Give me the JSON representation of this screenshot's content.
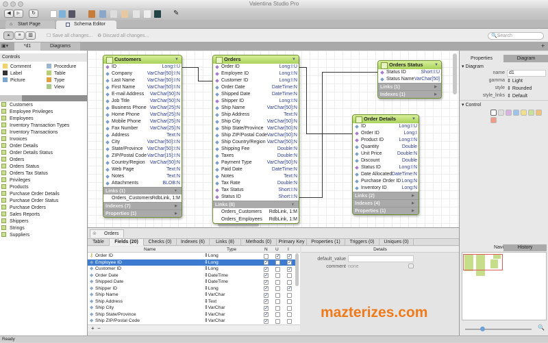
{
  "window": {
    "title": "Valentina Studio Pro"
  },
  "tabs": [
    {
      "label": "Start Page"
    },
    {
      "label": "Schema Editor"
    }
  ],
  "subbar": {
    "save": "Save all changes...",
    "discard": "Discard all changes...",
    "search_placeholder": "Search"
  },
  "doctabs": [
    {
      "label": "*d1"
    },
    {
      "label": "Diagrams"
    }
  ],
  "controls": {
    "title": "Controls",
    "items": [
      "Comment",
      "Label",
      "Picture",
      "Procedure",
      "Table",
      "Type",
      "View"
    ]
  },
  "objects": [
    "Customers",
    "Employee Privileges",
    "Employees",
    "Inventory Transaction Types",
    "Inventory Transactions",
    "Invoices",
    "Order Details",
    "Order Details Status",
    "Orders",
    "Orders Status",
    "Orders Tax Status",
    "Privileges",
    "Products",
    "Purchase Order Details",
    "Purchase Order Status",
    "Purchase Orders",
    "Sales Reports",
    "Shippers",
    "Strings",
    "Suppliers"
  ],
  "entities": [
    {
      "name": "Customers",
      "fields": [
        [
          "ID",
          "Long:I:U",
          1
        ],
        [
          "Company",
          "VarChar[50]:I:N",
          0
        ],
        [
          "Last Name",
          "VarChar[50]:I:N",
          0
        ],
        [
          "First Name",
          "VarChar[50]:I:N",
          0
        ],
        [
          "E-mail Address",
          "VarChar[50]:N",
          0
        ],
        [
          "Job Title",
          "VarChar[50]:N",
          0
        ],
        [
          "Business Phone",
          "VarChar[25]:N",
          0
        ],
        [
          "Home Phone",
          "VarChar[25]:N",
          0
        ],
        [
          "Mobile Phone",
          "VarChar[25]:N",
          0
        ],
        [
          "Fax Number",
          "VarChar[25]:N",
          0
        ],
        [
          "Address",
          "Text:N",
          0
        ],
        [
          "City",
          "VarChar[50]:I:N",
          0
        ],
        [
          "State/Province",
          "VarChar[50]:I:N",
          0
        ],
        [
          "ZIP/Postal Code",
          "VarChar[15]:I:N",
          0
        ],
        [
          "Country/Region",
          "VarChar[50]:N",
          0
        ],
        [
          "Web Page",
          "Text:N",
          0
        ],
        [
          "Notes",
          "Text:N",
          0
        ],
        [
          "Attachments",
          "BLOB:N",
          0
        ]
      ],
      "sections": [
        {
          "label": "Links (1)",
          "open": true,
          "items": [
            [
              "Orders_Customers",
              "RdbLink, 1:M"
            ]
          ]
        },
        {
          "label": "Indexes (7)"
        },
        {
          "label": "Properties (1)"
        }
      ]
    },
    {
      "name": "Orders",
      "fields": [
        [
          "Order ID",
          "Long:I:U",
          1
        ],
        [
          "Employee ID",
          "Long:I:N",
          1
        ],
        [
          "Customer ID",
          "Long:I:N",
          1
        ],
        [
          "Order Date",
          "DateTime:N",
          0
        ],
        [
          "Shipped Date",
          "DateTime:N",
          0
        ],
        [
          "Shipper ID",
          "Long:I:N",
          1
        ],
        [
          "Ship Name",
          "VarChar[50]:N",
          0
        ],
        [
          "Ship Address",
          "Text:N",
          0
        ],
        [
          "Ship City",
          "VarChar[50]:N",
          0
        ],
        [
          "Ship State/Province",
          "VarChar[50]:N",
          0
        ],
        [
          "Ship ZIP/Postal Code",
          "VarChar[50]:N",
          0
        ],
        [
          "Ship Country/Region",
          "VarChar[50]:N",
          0
        ],
        [
          "Shipping Fee",
          "Double:N",
          0
        ],
        [
          "Taxes",
          "Double:N",
          0
        ],
        [
          "Payment Type",
          "VarChar[50]:N",
          0
        ],
        [
          "Paid Date",
          "DateTime:N",
          0
        ],
        [
          "Notes",
          "Text:N",
          0
        ],
        [
          "Tax Rate",
          "Double:N",
          0
        ],
        [
          "Tax Status",
          "Short:I:N",
          1
        ],
        [
          "Status ID",
          "Short:I:N",
          1
        ]
      ],
      "sections": [
        {
          "label": "Links (8)",
          "open": true,
          "items": [
            [
              "Orders_Customers",
              "RdbLink, 1:M"
            ],
            [
              "Orders_Employees",
              "RdbLink, 1:M"
            ]
          ]
        }
      ]
    },
    {
      "name": "Orders Status",
      "fields": [
        [
          "Status ID",
          "Short:I:U",
          1
        ],
        [
          "Status Name",
          "VarChar[50]",
          0
        ]
      ],
      "sections": [
        {
          "label": "Links (1)"
        },
        {
          "label": "Indexes (1)"
        }
      ]
    },
    {
      "name": "Order Details",
      "fields": [
        [
          "ID",
          "Long:I:U",
          0
        ],
        [
          "Order ID",
          "Long:I",
          1
        ],
        [
          "Product ID",
          "Long:I:N",
          1
        ],
        [
          "Quantity",
          "Double",
          0
        ],
        [
          "Unit Price",
          "Double:N",
          0
        ],
        [
          "Discount",
          "Double",
          0
        ],
        [
          "Status ID",
          "Long:I:N",
          1
        ],
        [
          "Date Allocated",
          "DateTime:N",
          0
        ],
        [
          "Purchase Order ID",
          "Long:N",
          0
        ],
        [
          "Inventory ID",
          "Long:N",
          0
        ]
      ],
      "sections": [
        {
          "label": "Links (2)"
        },
        {
          "label": "Indexes (4)"
        },
        {
          "label": "Properties (1)"
        }
      ]
    }
  ],
  "properties": {
    "tabs": [
      "Properties",
      "Diagram"
    ],
    "section_diagram": "Diagram",
    "name_label": "name",
    "name_value": "d1",
    "gamma_label": "gamma",
    "gamma_value": "Light",
    "style_label": "style",
    "style_value": "Rounded",
    "links_label": "style_links",
    "links_value": "Default",
    "section_control": "Control",
    "swatches": [
      "#ffffff",
      "#dddddd",
      "#d9b3e0",
      "#9cc4ea",
      "#f0e08a",
      "#c8e09a",
      "#f2c27a",
      "#f09a8a"
    ]
  },
  "navigator": {
    "tabs": [
      "Navigator",
      "History"
    ]
  },
  "editor": {
    "tab": "Orders",
    "subtabs": [
      "Table",
      "Fields (20)",
      "Checks (0)",
      "Indexes (6)",
      "Links (8)",
      "Methods (0)",
      "Primary Key",
      "Properties (1)",
      "Triggers (0)",
      "Uniques (0)"
    ],
    "columns": [
      "Name",
      "Type",
      "N",
      "U",
      "I"
    ],
    "details_header": "Details",
    "rows": [
      [
        "Order ID",
        "Long",
        0,
        1,
        1
      ],
      [
        "Employee ID",
        "Long",
        1,
        0,
        1
      ],
      [
        "Customer ID",
        "Long",
        1,
        0,
        1
      ],
      [
        "Order Date",
        "DateTime",
        1,
        0,
        0
      ],
      [
        "Shipped Date",
        "DateTime",
        1,
        0,
        0
      ],
      [
        "Shipper ID",
        "Long",
        1,
        0,
        1
      ],
      [
        "Ship Name",
        "VarChar",
        1,
        0,
        0
      ],
      [
        "Ship Address",
        "Text",
        1,
        0,
        0
      ],
      [
        "Ship City",
        "VarChar",
        1,
        0,
        0
      ],
      [
        "Ship State/Province",
        "VarChar",
        1,
        0,
        0
      ],
      [
        "Ship ZIP/Postal Code",
        "VarChar",
        1,
        0,
        0
      ],
      [
        "Ship Country/Region",
        "VarChar",
        1,
        0,
        0
      ]
    ],
    "selected_row": 1,
    "default_value_label": "default_value",
    "default_value": "",
    "comment_label": "comment",
    "comment_value": "none"
  },
  "watermark": "mazterizes.com",
  "status": "Ready"
}
